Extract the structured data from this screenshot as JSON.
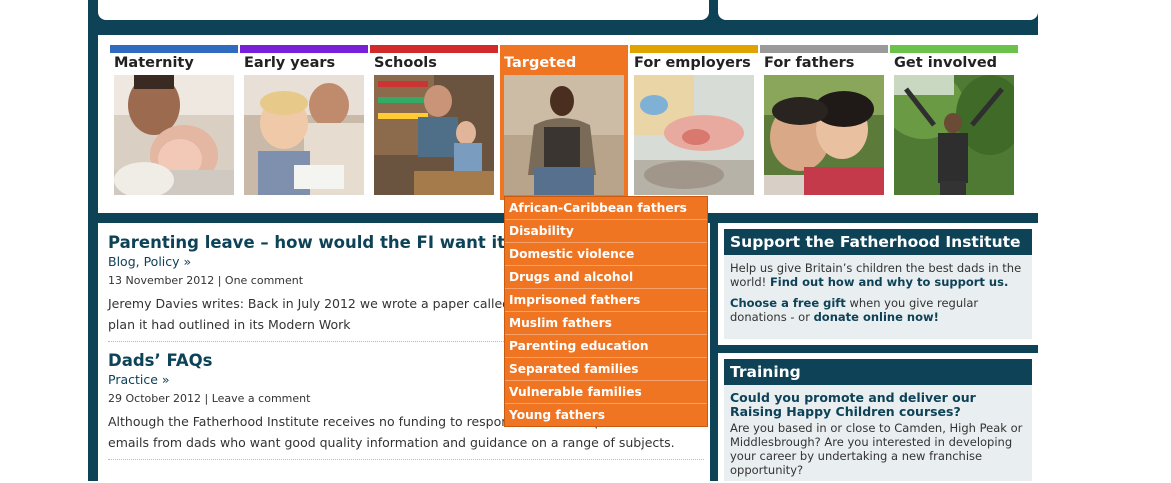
{
  "colors": {
    "brand": "#0d4257",
    "accent_orange": "#f07522",
    "tab_maternity": "#2f6bbf",
    "tab_early_years": "#7a1fd8",
    "tab_schools": "#d22a2a",
    "tab_targeted": "#f07522",
    "tab_employers": "#e0a300",
    "tab_fathers": "#9a9a9a",
    "tab_get_involved": "#6ac24a"
  },
  "nav": {
    "tabs": [
      {
        "label": "Maternity",
        "icon": "father-holding-newborn-photo"
      },
      {
        "label": "Early years",
        "icon": "father-toddler-reading-photo"
      },
      {
        "label": "Schools",
        "icon": "father-son-homework-photo"
      },
      {
        "label": "Targeted",
        "icon": "young-man-sitting-photo"
      },
      {
        "label": "For employers",
        "icon": "baby-hand-photo"
      },
      {
        "label": "For fathers",
        "icon": "father-daughter-hug-photo"
      },
      {
        "label": "Get involved",
        "icon": "man-arms-raised-photo"
      }
    ],
    "dropdown": [
      "African-Caribbean fathers",
      "Disability",
      "Domestic violence",
      "Drugs and alcohol",
      "Imprisoned fathers",
      "Muslim fathers",
      "Parenting education",
      "Separated families",
      "Vulnerable families",
      "Young fathers"
    ]
  },
  "posts": [
    {
      "title": "Parenting leave – how would the FI want it t",
      "categories": "Blog, Policy »",
      "meta": "13 November 2012 | One comment",
      "excerpt": "Jeremy Davies writes: Back in July 2012 we wrote a paper called S Government to pursue the plan it had outlined in its Modern Work"
    },
    {
      "title": "Dads’ FAQs",
      "categories": "Practice »",
      "meta": "29 October 2012 | Leave a comment",
      "excerpt": "Although the Fatherhood Institute receives no funding to respond receive telephone calls and emails from dads who want good quality information and guidance on a range of subjects."
    }
  ],
  "support": {
    "title": "Support the Fatherhood Institute",
    "text1": "Help us give Britain’s children the best dads in the world!",
    "link1": "Find out how and why to support us.",
    "gift_link": "Choose a free gift",
    "text2": "when you give regular donations - or",
    "donate_link": "donate online now!"
  },
  "training": {
    "title": "Training",
    "question": "Could you promote and deliver our Raising Happy Children courses?",
    "text": "Are you based in or close to Camden, High Peak or Middlesbrough? Are you interested in developing your career by undertaking a new franchise opportunity?"
  }
}
